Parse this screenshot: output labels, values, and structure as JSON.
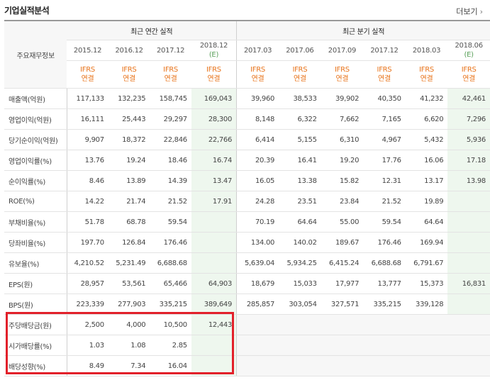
{
  "title": "기업실적분석",
  "more_label": "더보기",
  "row_header_label": "주요재무정보",
  "group_annual": "최근 연간 실적",
  "group_quarter": "최근 분기 실적",
  "periods": [
    "2015.12",
    "2016.12",
    "2017.12",
    "2018.12",
    "2017.03",
    "2017.06",
    "2017.09",
    "2017.12",
    "2018.03",
    "2018.06"
  ],
  "period_estimates": [
    "",
    "",
    "",
    "(E)",
    "",
    "",
    "",
    "",
    "",
    "(E)"
  ],
  "ifrs_label": "IFRS",
  "consol_label": "연결",
  "rows": [
    {
      "label": "매출액(억원)",
      "values": [
        "117,133",
        "132,235",
        "158,745",
        "169,043",
        "39,960",
        "38,533",
        "39,902",
        "40,350",
        "41,232",
        "42,461"
      ]
    },
    {
      "label": "영업이익(억원)",
      "values": [
        "16,111",
        "25,443",
        "29,297",
        "28,300",
        "8,148",
        "6,322",
        "7,662",
        "7,165",
        "6,620",
        "7,296"
      ]
    },
    {
      "label": "당기순이익(억원)",
      "values": [
        "9,907",
        "18,372",
        "22,846",
        "22,766",
        "6,414",
        "5,155",
        "6,310",
        "4,967",
        "5,432",
        "5,936"
      ]
    },
    {
      "label": "영업이익률(%)",
      "values": [
        "13.76",
        "19.24",
        "18.46",
        "16.74",
        "20.39",
        "16.41",
        "19.20",
        "17.76",
        "16.06",
        "17.18"
      ]
    },
    {
      "label": "순이익률(%)",
      "values": [
        "8.46",
        "13.89",
        "14.39",
        "13.47",
        "16.05",
        "13.38",
        "15.82",
        "12.31",
        "13.17",
        "13.98"
      ]
    },
    {
      "label": "ROE(%)",
      "values": [
        "14.22",
        "21.74",
        "21.52",
        "17.91",
        "24.28",
        "23.51",
        "23.84",
        "21.52",
        "19.89",
        ""
      ]
    },
    {
      "label": "부채비율(%)",
      "values": [
        "51.78",
        "68.78",
        "59.54",
        "",
        "70.19",
        "64.64",
        "55.00",
        "59.54",
        "64.64",
        ""
      ]
    },
    {
      "label": "당좌비율(%)",
      "values": [
        "197.70",
        "126.84",
        "176.46",
        "",
        "134.00",
        "140.02",
        "189.67",
        "176.46",
        "169.94",
        ""
      ]
    },
    {
      "label": "유보율(%)",
      "values": [
        "4,210.52",
        "5,231.49",
        "6,688.68",
        "",
        "5,639.04",
        "5,934.25",
        "6,415.24",
        "6,688.68",
        "6,791.67",
        ""
      ]
    },
    {
      "label": "EPS(원)",
      "values": [
        "28,957",
        "53,561",
        "65,466",
        "64,903",
        "18,679",
        "15,033",
        "17,977",
        "13,777",
        "15,373",
        "16,831"
      ]
    },
    {
      "label": "BPS(원)",
      "values": [
        "223,339",
        "277,903",
        "335,215",
        "389,649",
        "285,857",
        "303,054",
        "327,571",
        "335,215",
        "339,128",
        ""
      ]
    },
    {
      "label": "주당배당금(원)",
      "values": [
        "2,500",
        "4,000",
        "10,500",
        "12,443",
        "",
        "",
        "",
        "",
        "",
        ""
      ]
    },
    {
      "label": "시가배당률(%)",
      "values": [
        "1.03",
        "1.08",
        "2.85",
        "",
        "",
        "",
        "",
        "",
        "",
        ""
      ]
    },
    {
      "label": "배당성향(%)",
      "values": [
        "8.49",
        "7.34",
        "16.04",
        "",
        "",
        "",
        "",
        "",
        "",
        ""
      ]
    }
  ]
}
